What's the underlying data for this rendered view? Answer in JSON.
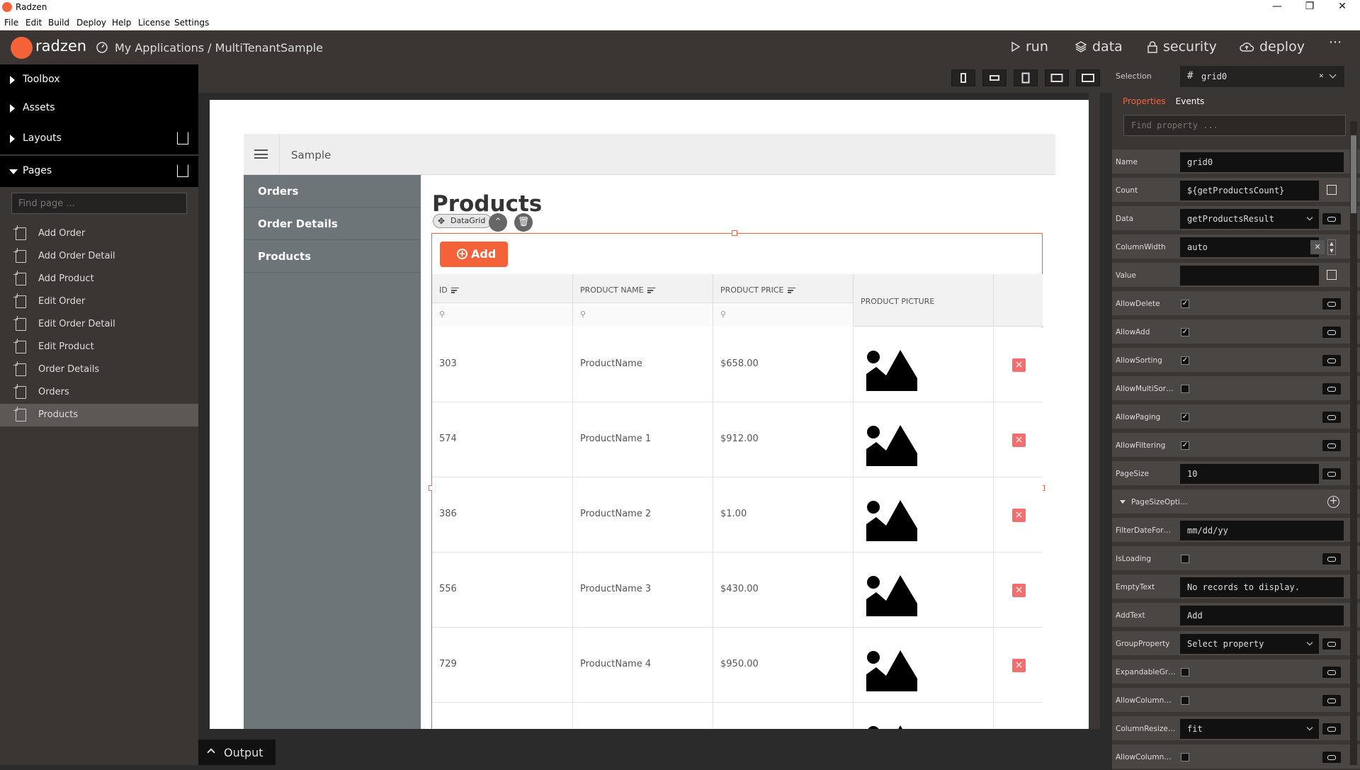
{
  "window": {
    "title": "Radzen"
  },
  "menu": [
    "File",
    "Edit",
    "Build",
    "Deploy",
    "Help",
    "License",
    "Settings"
  ],
  "app": {
    "logo": "radzen",
    "breadcrumb": "My Applications / MultiTenantSample",
    "accent": "#f4623a"
  },
  "actions": [
    {
      "label": "run",
      "icon": "play-icon"
    },
    {
      "label": "data",
      "icon": "layers-icon"
    },
    {
      "label": "security",
      "icon": "lock-icon"
    },
    {
      "label": "deploy",
      "icon": "cloud-upload-icon"
    }
  ],
  "left": {
    "sections": [
      "Toolbox",
      "Assets",
      "Layouts",
      "Pages"
    ],
    "find_placeholder": "Find page ...",
    "pages": [
      "Add Order",
      "Add Order Detail",
      "Add Product",
      "Edit Order",
      "Edit Order Detail",
      "Edit Product",
      "Order Details",
      "Orders",
      "Products"
    ],
    "selected_page": "Products"
  },
  "canvas": {
    "header_title": "Sample",
    "nav": [
      "Orders",
      "Order Details",
      "Products"
    ],
    "page_title": "Products",
    "component_chip": "DataGrid",
    "add_button": "Add",
    "columns": [
      "ID",
      "PRODUCT NAME",
      "PRODUCT PRICE",
      "PRODUCT PICTURE"
    ],
    "rows": [
      {
        "id": "303",
        "name": "ProductName",
        "price": "$658.00"
      },
      {
        "id": "574",
        "name": "ProductName 1",
        "price": "$912.00"
      },
      {
        "id": "386",
        "name": "ProductName 2",
        "price": "$1.00"
      },
      {
        "id": "556",
        "name": "ProductName 3",
        "price": "$430.00"
      },
      {
        "id": "729",
        "name": "ProductName 4",
        "price": "$950.00"
      }
    ]
  },
  "output": {
    "label": "Output"
  },
  "right": {
    "selection_label": "Selection",
    "selection_value": "grid0",
    "tabs": [
      "Properties",
      "Events"
    ],
    "find_placeholder": "Find property ...",
    "props": [
      {
        "name": "Name",
        "value": "grid0",
        "kind": "text"
      },
      {
        "name": "Count",
        "value": "${getProductsCount}",
        "kind": "text-edit"
      },
      {
        "name": "Data",
        "value": "getProductsResult",
        "kind": "select-bind"
      },
      {
        "name": "ColumnWidth",
        "value": "auto",
        "kind": "text-x"
      },
      {
        "name": "Value",
        "value": "",
        "kind": "text-edit"
      },
      {
        "name": "AllowDelete",
        "checked": true,
        "kind": "check"
      },
      {
        "name": "AllowAdd",
        "checked": true,
        "kind": "check"
      },
      {
        "name": "AllowSorting",
        "checked": true,
        "kind": "check"
      },
      {
        "name": "AllowMultiSorting",
        "checked": false,
        "kind": "check"
      },
      {
        "name": "AllowPaging",
        "checked": true,
        "kind": "check"
      },
      {
        "name": "AllowFiltering",
        "checked": true,
        "kind": "check"
      },
      {
        "name": "PageSize",
        "value": "10",
        "kind": "text-bind"
      },
      {
        "name": "PageSizeOptions",
        "kind": "group"
      },
      {
        "name": "FilterDateFormat",
        "value": "mm/dd/yy",
        "kind": "text"
      },
      {
        "name": "IsLoading",
        "checked": false,
        "kind": "check"
      },
      {
        "name": "EmptyText",
        "value": "No records to display.",
        "kind": "text"
      },
      {
        "name": "AddText",
        "value": "Add",
        "kind": "text"
      },
      {
        "name": "GroupProperty",
        "value": "Select property",
        "kind": "select-bind"
      },
      {
        "name": "ExpandableGroups",
        "checked": false,
        "kind": "check"
      },
      {
        "name": "AllowColumnRes...",
        "checked": false,
        "kind": "check"
      },
      {
        "name": "ColumnResizeM...",
        "value": "fit",
        "kind": "select-bind"
      },
      {
        "name": "AllowColumnReo...",
        "checked": false,
        "kind": "check"
      }
    ]
  }
}
